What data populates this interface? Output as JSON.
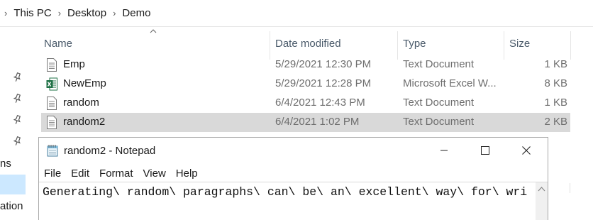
{
  "breadcrumb": {
    "items": [
      "This PC",
      "Desktop",
      "Demo"
    ]
  },
  "left_nav": {
    "fragments": [
      "ns",
      "ation"
    ],
    "pin_icons": [
      "pin-icon",
      "pin-icon",
      "pin-icon",
      "pin-icon"
    ]
  },
  "columns": {
    "name": "Name",
    "date": "Date modified",
    "type": "Type",
    "size": "Size",
    "sort_icon": "sort-ascending-icon"
  },
  "files": [
    {
      "name": "Emp",
      "date": "5/29/2021 12:30 PM",
      "type": "Text Document",
      "size": "1 KB",
      "icon": "text-file-icon",
      "selected": false
    },
    {
      "name": "NewEmp",
      "date": "5/29/2021 12:28 PM",
      "type": "Microsoft Excel W...",
      "size": "8 KB",
      "icon": "excel-file-icon",
      "selected": false
    },
    {
      "name": "random",
      "date": "6/4/2021 12:43 PM",
      "type": "Text Document",
      "size": "1 KB",
      "icon": "text-file-icon",
      "selected": false
    },
    {
      "name": "random2",
      "date": "6/4/2021 1:02 PM",
      "type": "Text Document",
      "size": "2 KB",
      "icon": "text-file-icon",
      "selected": true
    }
  ],
  "notepad": {
    "title": "random2 - Notepad",
    "icon": "notepad-icon",
    "controls": [
      "minimize-icon",
      "maximize-icon",
      "close-icon"
    ],
    "menu": [
      "File",
      "Edit",
      "Format",
      "View",
      "Help"
    ],
    "content": "Generating\\ random\\ paragraphs\\ can\\ be\\ an\\ excellent\\ way\\ for\\ wri"
  },
  "colors": {
    "selected_row": "#d9d9d9",
    "nav_selected": "#cce8ff",
    "excel_green": "#1d7044",
    "header_text": "#4a5a6a"
  }
}
